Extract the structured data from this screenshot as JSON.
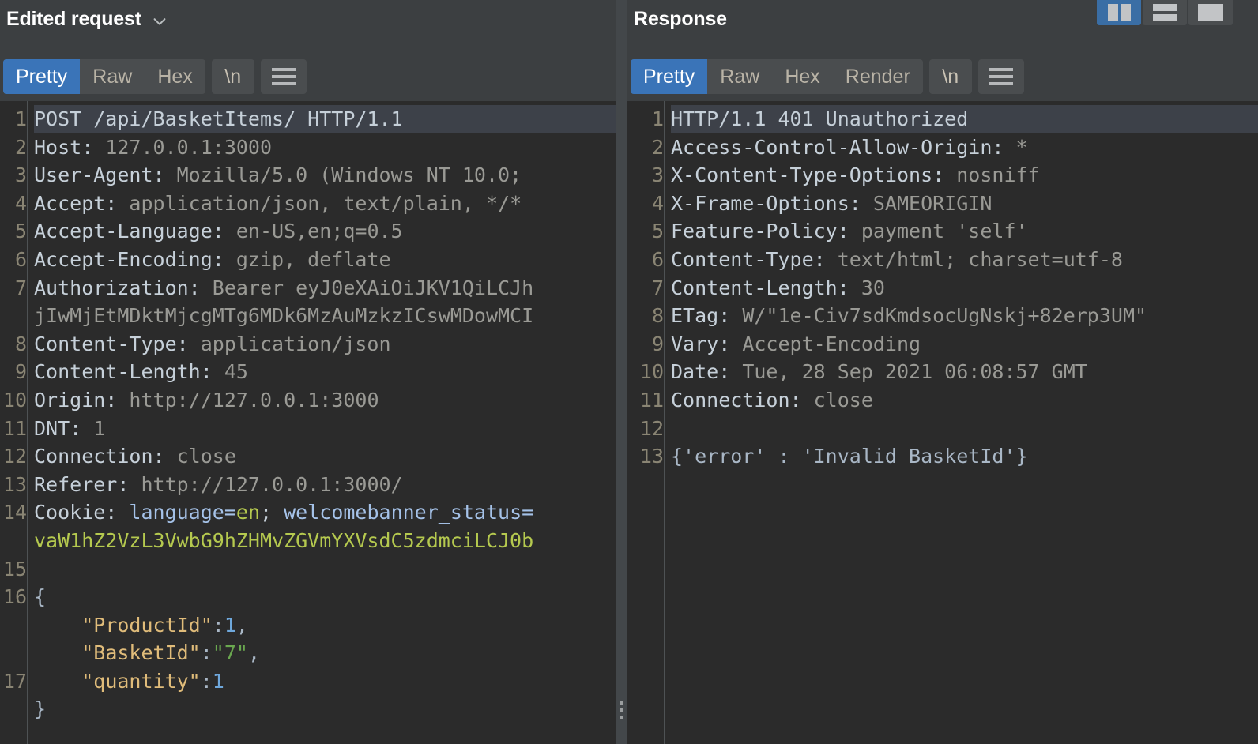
{
  "layout_buttons": [
    {
      "name": "vertical-split",
      "label": "Vertical split view",
      "active": true
    },
    {
      "name": "horizontal-split",
      "label": "Horizontal split view",
      "active": false
    },
    {
      "name": "single-pane",
      "label": "Single pane view",
      "active": false
    }
  ],
  "request": {
    "title": "Edited request",
    "dropdown_icon": "chevron-down-icon",
    "tabs": [
      {
        "label": "Pretty",
        "active": true
      },
      {
        "label": "Raw",
        "active": false
      },
      {
        "label": "Hex",
        "active": false
      }
    ],
    "newline_button": "\\n",
    "menu_icon": "hamburger-menu-icon",
    "lines": [
      {
        "num": "1",
        "highlight": true,
        "tokens": [
          {
            "t": "POST /api/BasketItems/ HTTP/1.1",
            "c": "k"
          }
        ]
      },
      {
        "num": "2",
        "tokens": [
          {
            "t": "Host: ",
            "c": "k"
          },
          {
            "t": "127.0.0.1:3000",
            "c": "v"
          }
        ]
      },
      {
        "num": "3",
        "tokens": [
          {
            "t": "User-Agent: ",
            "c": "k"
          },
          {
            "t": "Mozilla/5.0 (Windows NT 10.0;",
            "c": "v"
          }
        ]
      },
      {
        "num": "4",
        "tokens": [
          {
            "t": "Accept: ",
            "c": "k"
          },
          {
            "t": "application/json, text/plain, */*",
            "c": "v"
          }
        ]
      },
      {
        "num": "5",
        "tokens": [
          {
            "t": "Accept-Language: ",
            "c": "k"
          },
          {
            "t": "en-US,en;q=0.5",
            "c": "v"
          }
        ]
      },
      {
        "num": "6",
        "tokens": [
          {
            "t": "Accept-Encoding: ",
            "c": "k"
          },
          {
            "t": "gzip, deflate",
            "c": "v"
          }
        ]
      },
      {
        "num": "7",
        "tokens": [
          {
            "t": "Authorization: ",
            "c": "k"
          },
          {
            "t": "Bearer eyJ0eXAiOiJKV1QiLCJh",
            "c": "v"
          }
        ]
      },
      {
        "num": "",
        "tokens": [
          {
            "t": "jIwMjEtMDktMjcgMTg6MDk6MzAuMzkzICswMDowMCI",
            "c": "v"
          }
        ]
      },
      {
        "num": "8",
        "tokens": [
          {
            "t": "Content-Type: ",
            "c": "k"
          },
          {
            "t": "application/json",
            "c": "v"
          }
        ]
      },
      {
        "num": "9",
        "tokens": [
          {
            "t": "Content-Length: ",
            "c": "k"
          },
          {
            "t": "45",
            "c": "v"
          }
        ]
      },
      {
        "num": "10",
        "tokens": [
          {
            "t": "Origin: ",
            "c": "k"
          },
          {
            "t": "http://127.0.0.1:3000",
            "c": "v"
          }
        ]
      },
      {
        "num": "11",
        "tokens": [
          {
            "t": "DNT: ",
            "c": "k"
          },
          {
            "t": "1",
            "c": "v"
          }
        ]
      },
      {
        "num": "12",
        "tokens": [
          {
            "t": "Connection: ",
            "c": "k"
          },
          {
            "t": "close",
            "c": "v"
          }
        ]
      },
      {
        "num": "13",
        "tokens": [
          {
            "t": "Referer: ",
            "c": "k"
          },
          {
            "t": "http://127.0.0.1:3000/",
            "c": "v"
          }
        ]
      },
      {
        "num": "14",
        "tokens": [
          {
            "t": "Cookie: ",
            "c": "k"
          },
          {
            "t": "language=",
            "c": "ck"
          },
          {
            "t": "en",
            "c": "cv"
          },
          {
            "t": "; ",
            "c": "k"
          },
          {
            "t": "welcomebanner_status=",
            "c": "ck"
          }
        ]
      },
      {
        "num": "",
        "tokens": [
          {
            "t": "vaW1hZ2VzL3VwbG9hZHMvZGVmYXVsdC5zdmciLCJ0b",
            "c": "cv"
          }
        ]
      },
      {
        "num": "15",
        "tokens": [
          {
            "t": "",
            "c": "pl"
          }
        ]
      },
      {
        "num": "16",
        "tokens": [
          {
            "t": "{",
            "c": "jp"
          }
        ]
      },
      {
        "num": "",
        "tokens": [
          {
            "t": "    ",
            "c": "jp"
          },
          {
            "t": "\"ProductId\"",
            "c": "jk"
          },
          {
            "t": ":",
            "c": "jp"
          },
          {
            "t": "1",
            "c": "jn"
          },
          {
            "t": ",",
            "c": "jp"
          }
        ]
      },
      {
        "num": "",
        "tokens": [
          {
            "t": "    ",
            "c": "jp"
          },
          {
            "t": "\"BasketId\"",
            "c": "jk"
          },
          {
            "t": ":",
            "c": "jp"
          },
          {
            "t": "\"7\"",
            "c": "js"
          },
          {
            "t": ",",
            "c": "jp"
          }
        ]
      },
      {
        "num": "17",
        "tokens": [
          {
            "t": "    ",
            "c": "jp"
          },
          {
            "t": "\"quantity\"",
            "c": "jk"
          },
          {
            "t": ":",
            "c": "jp"
          },
          {
            "t": "1",
            "c": "jn"
          }
        ]
      },
      {
        "num": "",
        "tokens": [
          {
            "t": "}",
            "c": "jp"
          }
        ]
      }
    ]
  },
  "response": {
    "title": "Response",
    "tabs": [
      {
        "label": "Pretty",
        "active": true
      },
      {
        "label": "Raw",
        "active": false
      },
      {
        "label": "Hex",
        "active": false
      },
      {
        "label": "Render",
        "active": false
      }
    ],
    "newline_button": "\\n",
    "menu_icon": "hamburger-menu-icon",
    "lines": [
      {
        "num": "1",
        "highlight": true,
        "tokens": [
          {
            "t": "HTTP/1.1 401 Unauthorized",
            "c": "k"
          }
        ]
      },
      {
        "num": "2",
        "tokens": [
          {
            "t": "Access-Control-Allow-Origin: ",
            "c": "k"
          },
          {
            "t": "*",
            "c": "v"
          }
        ]
      },
      {
        "num": "3",
        "tokens": [
          {
            "t": "X-Content-Type-Options: ",
            "c": "k"
          },
          {
            "t": "nosniff",
            "c": "v"
          }
        ]
      },
      {
        "num": "4",
        "tokens": [
          {
            "t": "X-Frame-Options: ",
            "c": "k"
          },
          {
            "t": "SAMEORIGIN",
            "c": "v"
          }
        ]
      },
      {
        "num": "5",
        "tokens": [
          {
            "t": "Feature-Policy: ",
            "c": "k"
          },
          {
            "t": "payment 'self'",
            "c": "v"
          }
        ]
      },
      {
        "num": "6",
        "tokens": [
          {
            "t": "Content-Type: ",
            "c": "k"
          },
          {
            "t": "text/html; charset=utf-8",
            "c": "v"
          }
        ]
      },
      {
        "num": "7",
        "tokens": [
          {
            "t": "Content-Length: ",
            "c": "k"
          },
          {
            "t": "30",
            "c": "v"
          }
        ]
      },
      {
        "num": "8",
        "tokens": [
          {
            "t": "ETag: ",
            "c": "k"
          },
          {
            "t": "W/\"1e-Civ7sdKmdsocUgNskj+82erp3UM\"",
            "c": "v"
          }
        ]
      },
      {
        "num": "9",
        "tokens": [
          {
            "t": "Vary: ",
            "c": "k"
          },
          {
            "t": "Accept-Encoding",
            "c": "v"
          }
        ]
      },
      {
        "num": "10",
        "tokens": [
          {
            "t": "Date: ",
            "c": "k"
          },
          {
            "t": "Tue, 28 Sep 2021 06:08:57 GMT",
            "c": "v"
          }
        ]
      },
      {
        "num": "11",
        "tokens": [
          {
            "t": "Connection: ",
            "c": "k"
          },
          {
            "t": "close",
            "c": "v"
          }
        ]
      },
      {
        "num": "12",
        "tokens": [
          {
            "t": "",
            "c": "pl"
          }
        ]
      },
      {
        "num": "13",
        "tokens": [
          {
            "t": "{'error' : 'Invalid BasketId'}",
            "c": "pl"
          }
        ]
      }
    ]
  }
}
